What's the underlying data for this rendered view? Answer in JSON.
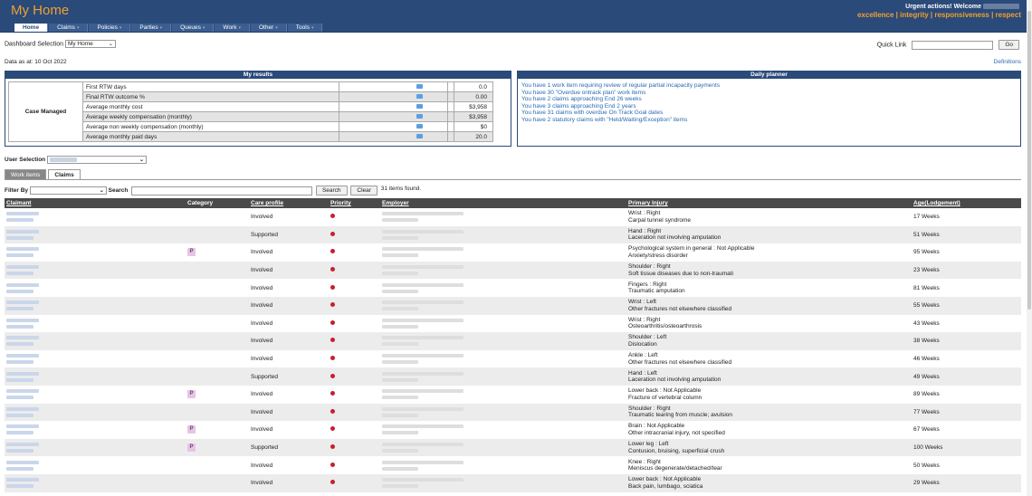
{
  "header": {
    "app_title": "My Home",
    "urgent_label": "Urgent actions!",
    "welcome_label": "Welcome",
    "slogan": "excellence | integrity | responsiveness | respect"
  },
  "nav": {
    "items": [
      "Home",
      "Claims",
      "Policies",
      "Parties",
      "Queues",
      "Work",
      "Other",
      "Tools"
    ]
  },
  "dashboard": {
    "label": "Dashboard Selection",
    "value": "My Home"
  },
  "quick_link": {
    "label": "Quick Link",
    "value": "",
    "go_label": "Go"
  },
  "data_as_at": "Data as at: 10 Oct 2022",
  "definitions_label": "Definitions",
  "my_results": {
    "title": "My results",
    "row_group": "Case Managed",
    "rows": [
      {
        "label": "First RTW days",
        "value": "0.0"
      },
      {
        "label": "Final RTW outcome %",
        "value": "0.00"
      },
      {
        "label": "Average monthly cost",
        "value": "$3,958"
      },
      {
        "label": "Average weekly compensation (monthly)",
        "value": "$3,958"
      },
      {
        "label": "Average non weekly compensation (monthly)",
        "value": "$0"
      },
      {
        "label": "Average monthly paid days",
        "value": "20.0"
      }
    ]
  },
  "daily_planner": {
    "title": "Daily planner",
    "items": [
      "You have 1 work item requiring review of regular partial incapacity payments",
      "You have 30 \"Overdue ontrack plan\" work items",
      "You have 2 claims approaching End 26 weeks",
      "You have 3 claims approaching End 2 years",
      "You have 31 claims with overdue On Track Goal dates",
      "You have 2 statutory claims with \"Held/Waiting/Exception\" items"
    ]
  },
  "user_selection": {
    "label": "User Selection"
  },
  "tabs": [
    "Work items",
    "Claims"
  ],
  "filter": {
    "label": "Filter By",
    "search_label": "Search",
    "search_value": "",
    "search_button": "Search",
    "clear_button": "Clear",
    "found_text": "31 items found."
  },
  "table": {
    "headers": {
      "claimant": "Claimant",
      "category": "Category",
      "care_profile": "Care profile",
      "priority": "Priority",
      "employer": "Employer",
      "primary_injury": "Primary Injury",
      "age": "Age(Lodgement)"
    },
    "rows": [
      {
        "category": "",
        "care": "Involved",
        "inj1": "Wrist : Right",
        "inj2": "Carpal tunnel syndrome",
        "age": "17 Weeks"
      },
      {
        "category": "",
        "care": "Supported",
        "inj1": "Hand : Right",
        "inj2": "Laceration not involving amputation",
        "age": "51 Weeks"
      },
      {
        "category": "P",
        "care": "Involved",
        "inj1": "Psychological system in general : Not Applicable",
        "inj2": "Anxiety/stress disorder",
        "age": "95 Weeks"
      },
      {
        "category": "",
        "care": "Involved",
        "inj1": "Shoulder : Right",
        "inj2": "Soft tissue diseases due to non-traumati",
        "age": "23 Weeks"
      },
      {
        "category": "",
        "care": "Involved",
        "inj1": "Fingers : Right",
        "inj2": "Traumatic amputation",
        "age": "81 Weeks"
      },
      {
        "category": "",
        "care": "Involved",
        "inj1": "Wrist : Left",
        "inj2": "Other fractures not elsewhere classified",
        "age": "55 Weeks"
      },
      {
        "category": "",
        "care": "Involved",
        "inj1": "Wrist : Right",
        "inj2": "Osteoarthritis/osteoarthrosis",
        "age": "43 Weeks"
      },
      {
        "category": "",
        "care": "Involved",
        "inj1": "Shoulder : Left",
        "inj2": "Dislocation",
        "age": "38 Weeks"
      },
      {
        "category": "",
        "care": "Involved",
        "inj1": "Ankle : Left",
        "inj2": "Other fractures not elsewhere classified",
        "age": "46 Weeks"
      },
      {
        "category": "",
        "care": "Supported",
        "inj1": "Hand : Left",
        "inj2": "Laceration not involving amputation",
        "age": "49 Weeks"
      },
      {
        "category": "P",
        "care": "Involved",
        "inj1": "Lower back : Not Applicable",
        "inj2": "Fracture of vertebral column",
        "age": "89 Weeks"
      },
      {
        "category": "",
        "care": "Involved",
        "inj1": "Shoulder : Right",
        "inj2": "Traumatic tearing from muscle; avulsion",
        "age": "77 Weeks"
      },
      {
        "category": "P",
        "care": "Involved",
        "inj1": "Brain : Not Applicable",
        "inj2": "Other intracranial injury, not specified",
        "age": "67 Weeks"
      },
      {
        "category": "P",
        "care": "Supported",
        "inj1": "Lower leg : Left",
        "inj2": "Contusion, bruising, superficial crush",
        "age": "100 Weeks"
      },
      {
        "category": "",
        "care": "Involved",
        "inj1": "Knee : Right",
        "inj2": "Meniscus degenerate/detached/tear",
        "age": "50 Weeks"
      },
      {
        "category": "",
        "care": "Involved",
        "inj1": "Lower back : Not Applicable",
        "inj2": "Back pain, lumbago, sciatica",
        "age": "29 Weeks"
      }
    ]
  },
  "colors": {
    "header_bg": "#2a4a7a",
    "accent_orange": "#f0a030",
    "link_blue": "#2a6ab0",
    "priority_red": "#c81e2e",
    "table_header": "#4a4a4a"
  }
}
